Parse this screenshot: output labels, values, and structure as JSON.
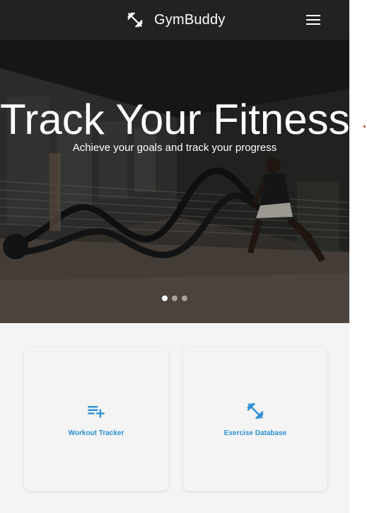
{
  "header": {
    "brand_name": "GymBuddy",
    "brand_icon": "dumbbell-icon",
    "menu_icon": "hamburger-menu-icon"
  },
  "hero": {
    "title": "Track Your Fitness",
    "subtitle": "Achieve your goals and track your progress",
    "carousel": {
      "slide_count": 3,
      "active_index": 0
    }
  },
  "features": [
    {
      "label": "Workout Tracker",
      "icon": "playlist-add-icon"
    },
    {
      "label": "Exercise Database",
      "icon": "dumbbell-icon"
    }
  ],
  "colors": {
    "header_bg": "#222222",
    "accent": "#2a8fd4",
    "page_bg": "#f4f4f4"
  }
}
